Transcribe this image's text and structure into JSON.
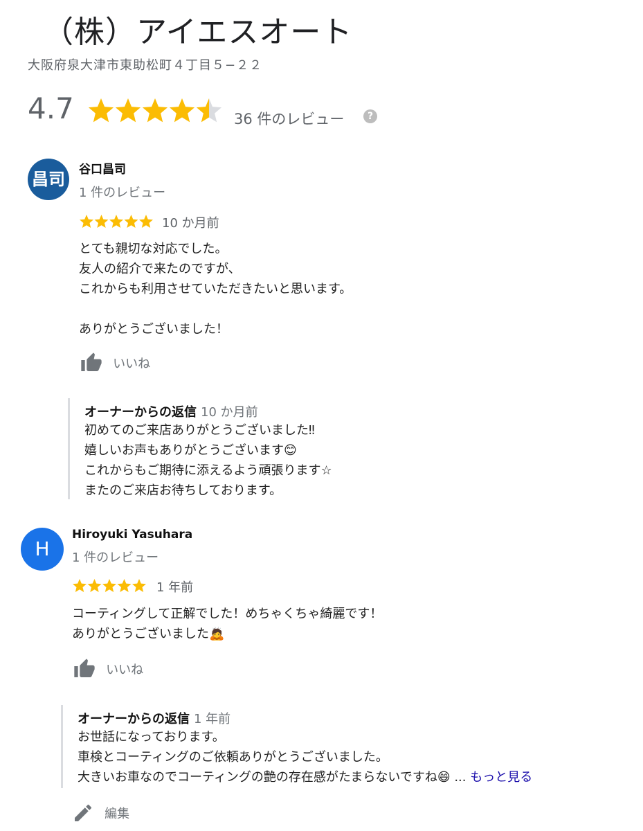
{
  "business": {
    "name": "（株）アイエスオート",
    "address": "大阪府泉大津市東助松町４丁目５−２２",
    "rating": "4.7",
    "rating_value": 4.7,
    "review_count_label": "36 件のレビュー",
    "help_glyph": "?"
  },
  "colors": {
    "star": "#fbbc04",
    "star_empty": "#dadce0",
    "link": "#1a0dab"
  },
  "reviews": [
    {
      "avatar_text": "昌司",
      "name": "谷口昌司",
      "review_count": "1 件のレビュー",
      "stars": 5,
      "time": "10 か月前",
      "text": "とても親切な対応でした。\n友人の紹介で来たのですが、\nこれからも利用させていただきたいと思います。\n\nありがとうございました！",
      "like_label": "いいね",
      "owner_reply_label": "オーナーからの返信",
      "owner_reply_time": "10 か月前",
      "owner_reply_text": "初めてのご来店ありがとうございました‼\n嬉しいお声もありがとうございます😊\nこれからもご期待に添えるよう頑張ります☆\nまたのご来店お待ちしております。"
    },
    {
      "avatar_text": "H",
      "name": "Hiroyuki Yasuhara",
      "review_count": "1 件のレビュー",
      "stars": 5,
      "time": "1 年前",
      "text": "コーティングして正解でした！めちゃくちゃ綺麗です！\nありがとうございました🙇",
      "like_label": "いいね",
      "owner_reply_label": "オーナーからの返信",
      "owner_reply_time": "1 年前",
      "owner_reply_text": "お世話になっております。\n車検とコーティングのご依頼ありがとうございました。\n大きいお車なのでコーティングの艶の存在感がたまらないですね😄 ...",
      "more_label": "もっと見る"
    }
  ],
  "edit_label": "編集",
  "icons": {
    "like": "thumbs-up-icon",
    "edit": "pencil-icon",
    "help": "question-mark-icon",
    "star": "star-icon"
  }
}
